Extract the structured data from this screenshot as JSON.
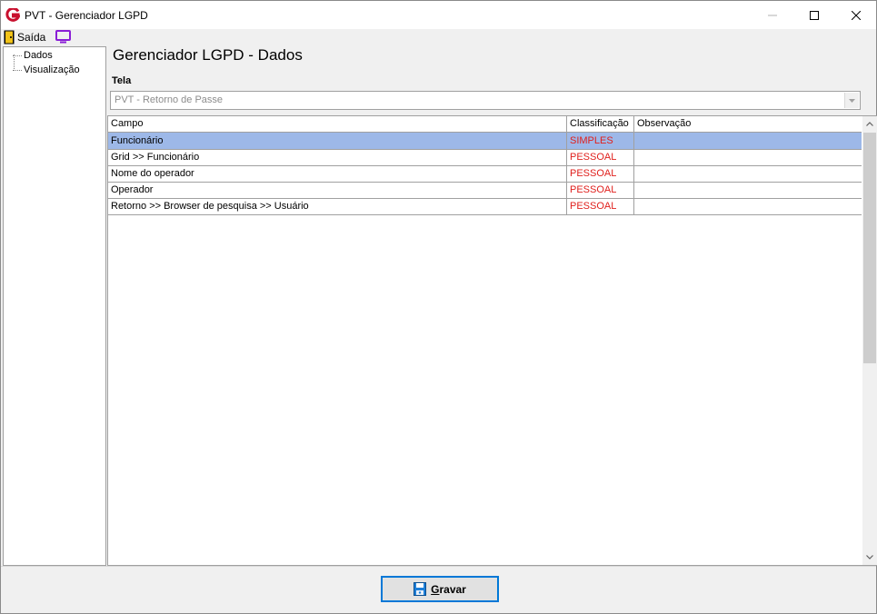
{
  "window": {
    "title": "PVT - Gerenciador LGPD"
  },
  "menu": {
    "exit_label": "Saída"
  },
  "tree": {
    "items": [
      {
        "label": "Dados"
      },
      {
        "label": "Visualização"
      }
    ]
  },
  "main": {
    "title": "Gerenciador LGPD - Dados",
    "tela_label": "Tela",
    "tela_value": "PVT - Retorno de Passe"
  },
  "grid": {
    "columns": [
      "Campo",
      "Classificação",
      "Observação"
    ],
    "rows": [
      {
        "campo": "Funcionário",
        "classificacao": "SIMPLES",
        "observacao": "",
        "selected": true
      },
      {
        "campo": "Grid >> Funcionário",
        "classificacao": "PESSOAL",
        "observacao": ""
      },
      {
        "campo": "Nome do operador",
        "classificacao": "PESSOAL",
        "observacao": ""
      },
      {
        "campo": "Operador",
        "classificacao": "PESSOAL",
        "observacao": ""
      },
      {
        "campo": "Retorno >> Browser de pesquisa >> Usuário",
        "classificacao": "PESSOAL",
        "observacao": ""
      }
    ]
  },
  "footer": {
    "save_label_accel": "G",
    "save_label_rest": "ravar"
  },
  "colors": {
    "selection": "#9db8e8",
    "classification_text": "#e0201d",
    "focus_border": "#0078d7"
  }
}
